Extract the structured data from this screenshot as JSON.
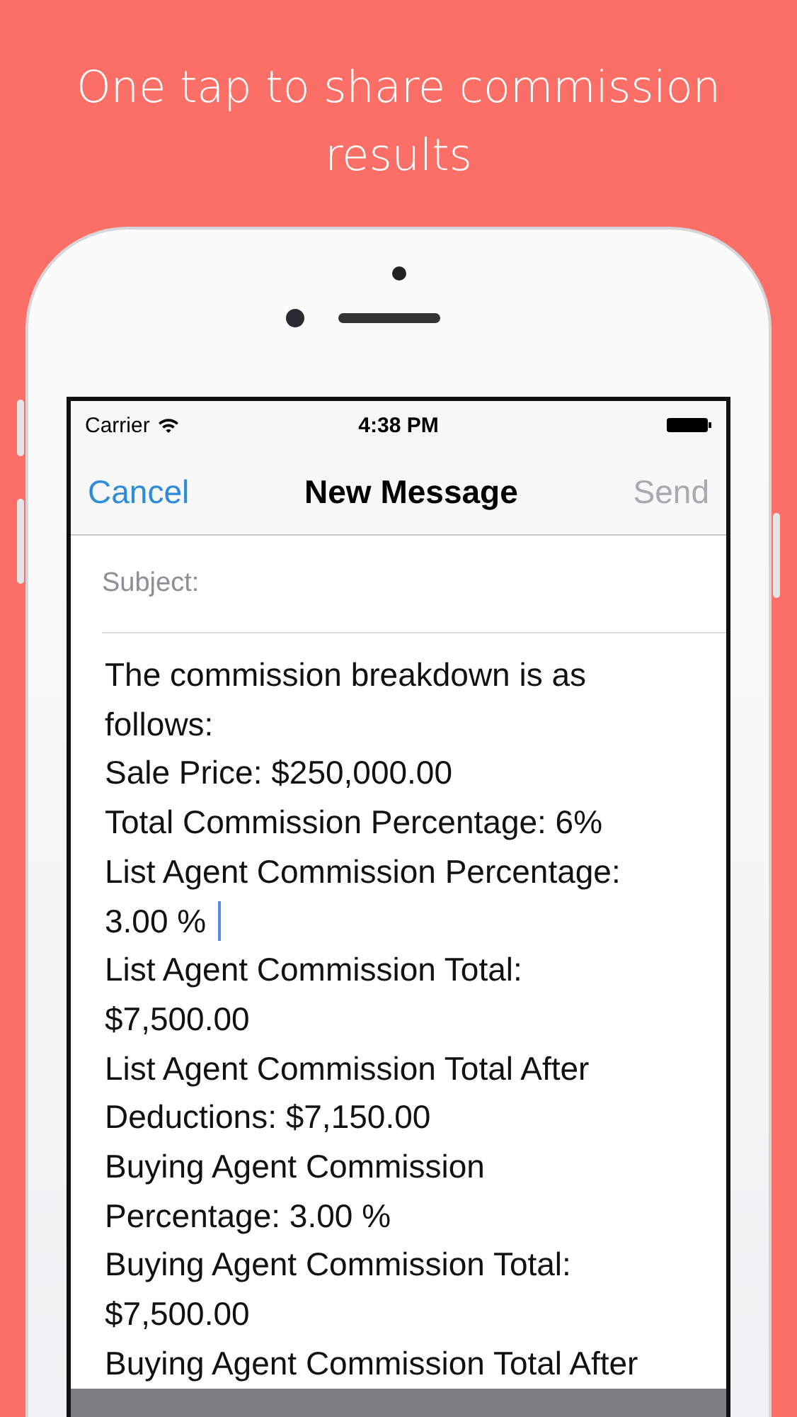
{
  "headline": "One tap to share commission results",
  "status_bar": {
    "carrier": "Carrier",
    "time": "4:38 PM"
  },
  "nav_bar": {
    "cancel": "Cancel",
    "title": "New Message",
    "send": "Send",
    "send_disabled": true
  },
  "subject": {
    "placeholder": "Subject:"
  },
  "body_lines": [
    {
      "text": "The commission breakdown is as",
      "cursor": false
    },
    {
      "text": "follows:",
      "cursor": false
    },
    {
      "text": "Sale Price: $250,000.00",
      "cursor": false
    },
    {
      "text": "Total Commission Percentage: 6%",
      "cursor": false
    },
    {
      "text": "List Agent Commission Percentage:",
      "cursor": false
    },
    {
      "text": "3.00 %",
      "cursor": true
    },
    {
      "text": "List Agent Commission Total:",
      "cursor": false
    },
    {
      "text": "$7,500.00",
      "cursor": false
    },
    {
      "text": "List Agent Commission Total After",
      "cursor": false
    },
    {
      "text": "Deductions: $7,150.00",
      "cursor": false
    },
    {
      "text": "Buying Agent Commission",
      "cursor": false
    },
    {
      "text": "Percentage: 3.00 %",
      "cursor": false
    },
    {
      "text": "Buying Agent Commission Total:",
      "cursor": false
    },
    {
      "text": "$7,500.00",
      "cursor": false
    },
    {
      "text": "Buying Agent Commission Total After",
      "cursor": false
    }
  ]
}
